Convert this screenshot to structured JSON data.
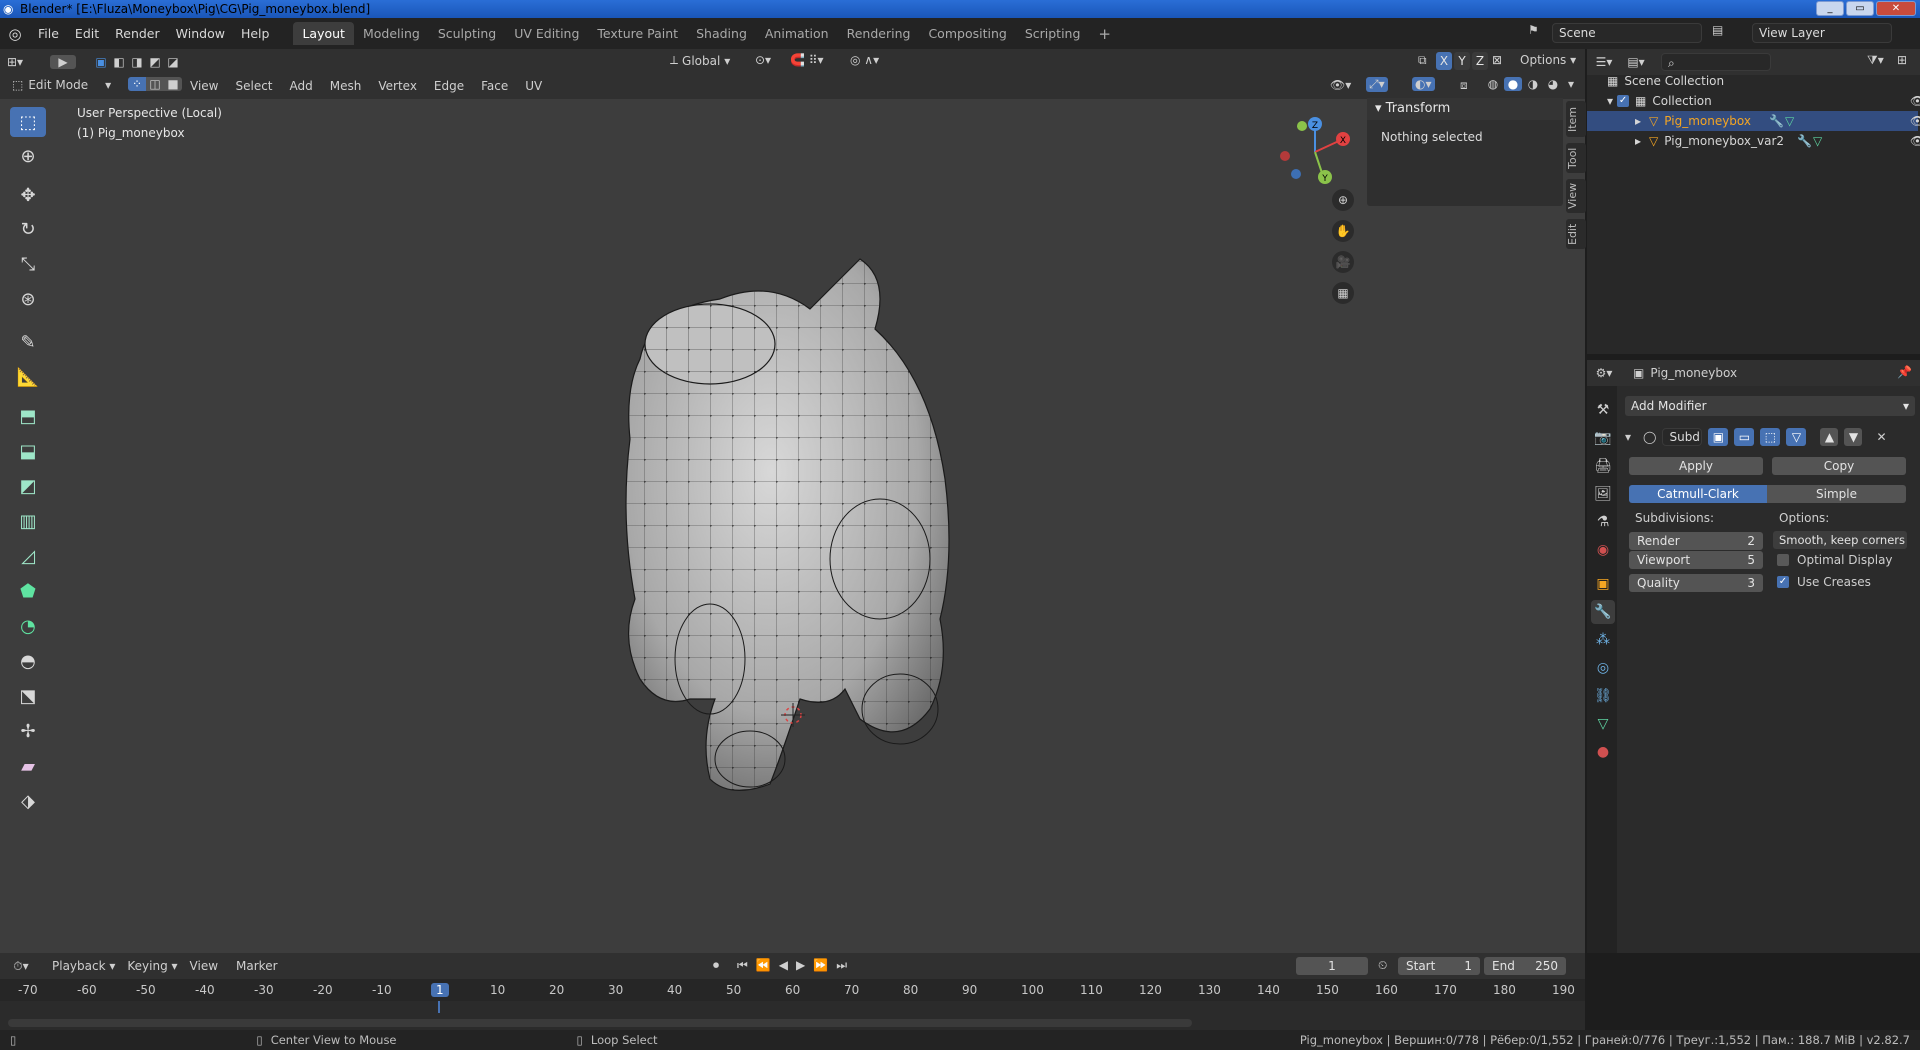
{
  "title": "Blender* [E:\\Fluza\\Moneybox\\Pig\\CG\\Pig_moneybox.blend]",
  "menus": [
    "File",
    "Edit",
    "Render",
    "Window",
    "Help"
  ],
  "workspaces": [
    "Layout",
    "Modeling",
    "Sculpting",
    "UV Editing",
    "Texture Paint",
    "Shading",
    "Animation",
    "Rendering",
    "Compositing",
    "Scripting"
  ],
  "active_workspace": "Layout",
  "scene": "Scene",
  "view_layer": "View Layer",
  "viewport_header": {
    "transform_orientation": "Global",
    "options": "Options",
    "axes": [
      "X",
      "Y",
      "Z"
    ]
  },
  "edit_header": {
    "mode": "Edit Mode",
    "menus": [
      "View",
      "Select",
      "Add",
      "Mesh",
      "Vertex",
      "Edge",
      "Face",
      "UV"
    ]
  },
  "viewport": {
    "perspective": "User Perspective (Local)",
    "object": "(1) Pig_moneybox",
    "gizmo_axes": [
      "Z",
      "X",
      "Y"
    ]
  },
  "npanel": {
    "section": "Transform",
    "status": "Nothing selected",
    "tabs": [
      "Item",
      "Tool",
      "View",
      "Edit"
    ]
  },
  "outliner": {
    "root": "Scene Collection",
    "collection": "Collection",
    "objects": [
      "Pig_moneybox",
      "Pig_moneybox_var2"
    ],
    "selected": "Pig_moneybox"
  },
  "properties": {
    "object": "Pig_moneybox",
    "add_modifier": "Add Modifier",
    "modifier_name": "Subd",
    "apply": "Apply",
    "copy": "Copy",
    "methods": [
      "Catmull-Clark",
      "Simple"
    ],
    "active_method": "Catmull-Clark",
    "subdivisions_label": "Subdivisions:",
    "options_label": "Options:",
    "render_label": "Render",
    "render_value": "2",
    "viewport_label": "Viewport",
    "viewport_value": "5",
    "quality_label": "Quality",
    "quality_value": "3",
    "uv_smooth": "Smooth, keep corners",
    "optimal_display_label": "Optimal Display",
    "optimal_display": false,
    "use_creases_label": "Use Creases",
    "use_creases": true
  },
  "timeline": {
    "menus": [
      "Playback",
      "Keying",
      "View",
      "Marker"
    ],
    "current_frame": "1",
    "start_label": "Start",
    "start": "1",
    "end_label": "End",
    "end": "250",
    "ticks": [
      "-70",
      "-60",
      "-50",
      "-40",
      "-30",
      "-20",
      "-10",
      "1",
      "10",
      "20",
      "30",
      "40",
      "50",
      "60",
      "70",
      "80",
      "90",
      "100",
      "110",
      "120",
      "130",
      "140",
      "150",
      "160",
      "170",
      "180",
      "190"
    ]
  },
  "statusbar": {
    "hint1": "Center View to Mouse",
    "hint2": "Loop Select",
    "stats": "Pig_moneybox | Вершин:0/778 | Рёбер:0/1,552 | Граней:0/776 | Треуг.:1,552 | Пам.: 188.7 MiB | v2.82.7"
  },
  "colors": {
    "accent": "#4772b3",
    "selected_object": "#f5a623",
    "viewport_bg": "#3d3d3d",
    "axis_x": "#e14141",
    "axis_y": "#8bc34a",
    "axis_z": "#4a90e2"
  }
}
